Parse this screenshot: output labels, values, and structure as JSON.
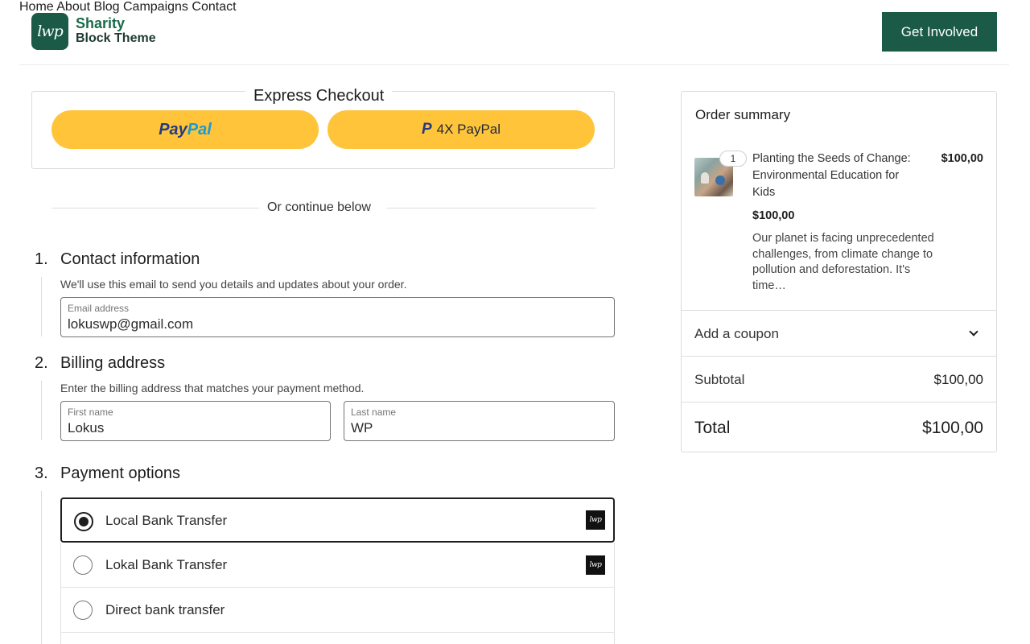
{
  "header": {
    "logo_text": "lwp",
    "brand_line1": "Sharity",
    "brand_line2": "Block Theme",
    "nav": [
      "Home",
      "About",
      "Blog",
      "Campaigns",
      "Contact"
    ],
    "cta_label": "Get Involved"
  },
  "express": {
    "title": "Express Checkout",
    "paypal_part1": "Pay",
    "paypal_part2": "Pal",
    "paylater_mark": "P",
    "paylater_label": "4X PayPal"
  },
  "divider_text": "Or continue below",
  "contact": {
    "number": "1.",
    "title": "Contact information",
    "description": "We'll use this email to send you details and updates about your order.",
    "email_label": "Email address",
    "email_value": "lokuswp@gmail.com"
  },
  "billing": {
    "number": "2.",
    "title": "Billing address",
    "description": "Enter the billing address that matches your payment method.",
    "first_name_label": "First name",
    "first_name_value": "Lokus",
    "last_name_label": "Last name",
    "last_name_value": "WP"
  },
  "payment": {
    "number": "3.",
    "title": "Payment options",
    "options": [
      {
        "label": "Local Bank Transfer",
        "selected": true,
        "logo": "lwp"
      },
      {
        "label": "Lokal Bank Transfer",
        "selected": false,
        "logo": "lwp"
      },
      {
        "label": "Direct bank transfer",
        "selected": false,
        "logo": ""
      }
    ]
  },
  "summary": {
    "title": "Order summary",
    "item": {
      "quantity": "1",
      "name": "Planting the Seeds of Change: Environmental Education for Kids",
      "line_price": "$100,00",
      "unit_price": "$100,00",
      "description": "Our planet is facing unprecedented challenges, from climate change to pollution and deforestation. It's time…"
    },
    "coupon_label": "Add a coupon",
    "subtotal_label": "Subtotal",
    "subtotal_value": "$100,00",
    "total_label": "Total",
    "total_value": "$100,00"
  },
  "colors": {
    "brand_green": "#1a5a46",
    "paypal_yellow": "#ffc439",
    "paypal_dark_blue": "#253b80",
    "paypal_light_blue": "#179bd7"
  }
}
